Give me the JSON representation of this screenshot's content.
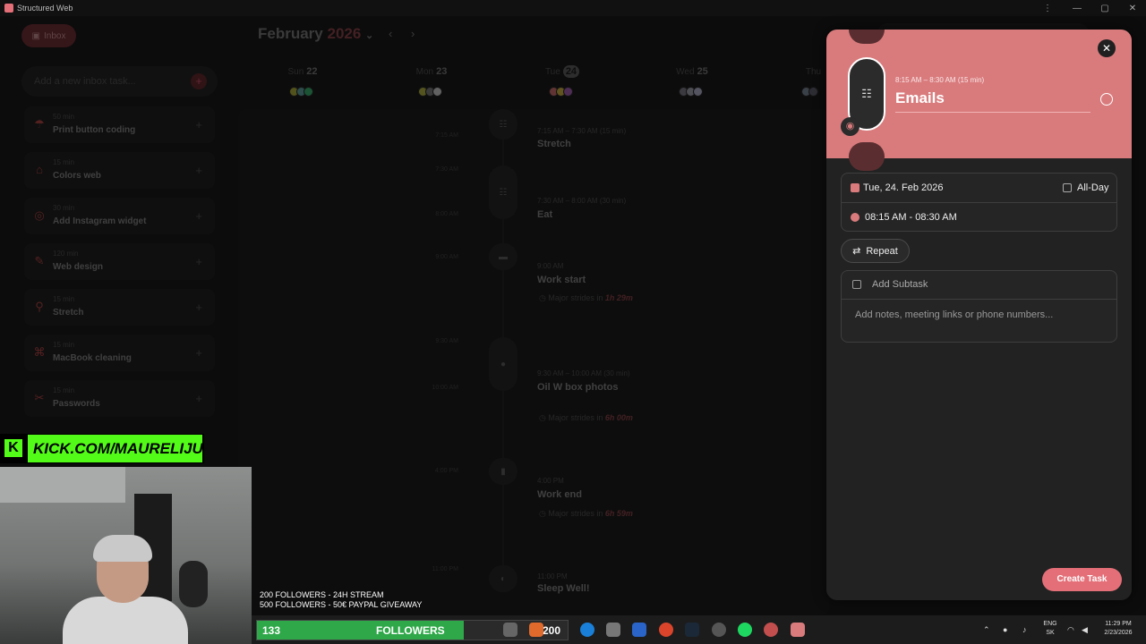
{
  "window": {
    "title": "Structured Web",
    "controls": [
      "⋮",
      "—",
      "▢",
      "✕"
    ]
  },
  "sidebar": {
    "inbox_label": "Inbox",
    "new_task_placeholder": "Add a new inbox task...",
    "items": [
      {
        "duration": "50 min",
        "name": "Print button coding"
      },
      {
        "duration": "15 min",
        "name": "Colors web"
      },
      {
        "duration": "30 min",
        "name": "Add Instagram widget"
      },
      {
        "duration": "120 min",
        "name": "Web design"
      },
      {
        "duration": "15 min",
        "name": "Stretch"
      },
      {
        "duration": "15 min",
        "name": "MacBook cleaning"
      },
      {
        "duration": "15 min",
        "name": "Passwords"
      }
    ]
  },
  "calendar": {
    "month": "February",
    "year": "2026",
    "days": [
      {
        "dow": "Sun",
        "num": "22"
      },
      {
        "dow": "Mon",
        "num": "23"
      },
      {
        "dow": "Tue",
        "num": "24"
      },
      {
        "dow": "Wed",
        "num": "25"
      },
      {
        "dow": "Thu",
        "num": ""
      }
    ]
  },
  "timeline": {
    "side_times": [
      "7:15 AM",
      "7:30 AM",
      "8:00 AM",
      "9:00 AM",
      "9:30 AM",
      "10:00 AM",
      "4:00 PM",
      "11:00 PM"
    ],
    "events": [
      {
        "time": "7:15 AM – 7:30 AM (15 min)",
        "name": "Stretch"
      },
      {
        "time": "7:30 AM – 8:00 AM (30 min)",
        "name": "Eat"
      },
      {
        "time": "9:00 AM",
        "name": "Work start"
      },
      {
        "time": "9:30 AM – 10:00 AM (30 min)",
        "name": "Oil W box photos"
      },
      {
        "time": "4:00 PM",
        "name": "Work end"
      },
      {
        "time": "11:00 PM",
        "name": "Sleep Well!"
      }
    ],
    "strides": [
      {
        "text": "Major strides in",
        "value": "1h 29m"
      },
      {
        "text": "Major strides in",
        "value": "6h 00m"
      },
      {
        "text": "Major strides in",
        "value": "6h 59m"
      }
    ]
  },
  "task_panel": {
    "time_range": "8:15 AM – 8:30 AM",
    "duration": "(15 min)",
    "title": "Emails",
    "date": "Tue, 24. Feb 2026",
    "all_day_label": "All-Day",
    "time": "08:15 AM - 08:30 AM",
    "repeat_label": "Repeat",
    "subtask_placeholder": "Add Subtask",
    "notes_placeholder": "Add notes, meeting links or phone numbers...",
    "create_label": "Create Task",
    "accent": "#d97b7d"
  },
  "stream": {
    "kick_url": "KICK.COM/MAURELIJU",
    "goal_line1": "200 FOLLOWERS - 24H STREAM",
    "goal_line2": "500 FOLLOWERS - 50€ PAYPAL GIVEAWAY",
    "followers_count": "133",
    "followers_label": "FOLLOWERS",
    "followers_goal": "200",
    "followers_fraction": 0.665
  },
  "tray": {
    "lang": "ENG",
    "region": "SK",
    "time": "11:29 PM",
    "date": "2/23/2026"
  }
}
